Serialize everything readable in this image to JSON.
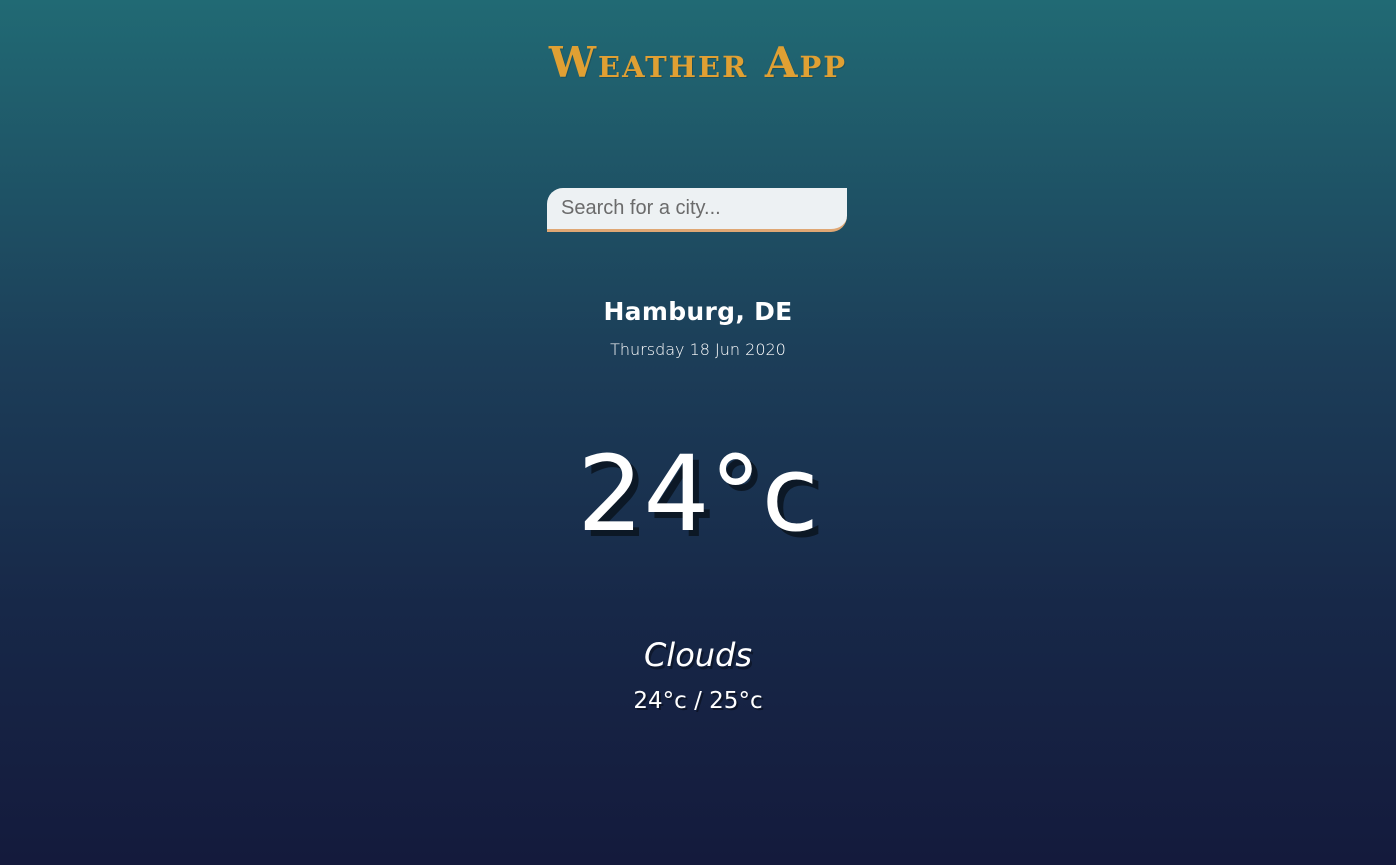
{
  "app": {
    "title": "Weather App",
    "accent_color": "#e0a033"
  },
  "search": {
    "placeholder": "Search for a city...",
    "value": ""
  },
  "location": {
    "city": "Hamburg, DE",
    "date": "Thursday 18 Jun 2020"
  },
  "current": {
    "temperature": "24°c",
    "weather": "Clouds",
    "hi_low": "24°c / 25°c"
  }
}
